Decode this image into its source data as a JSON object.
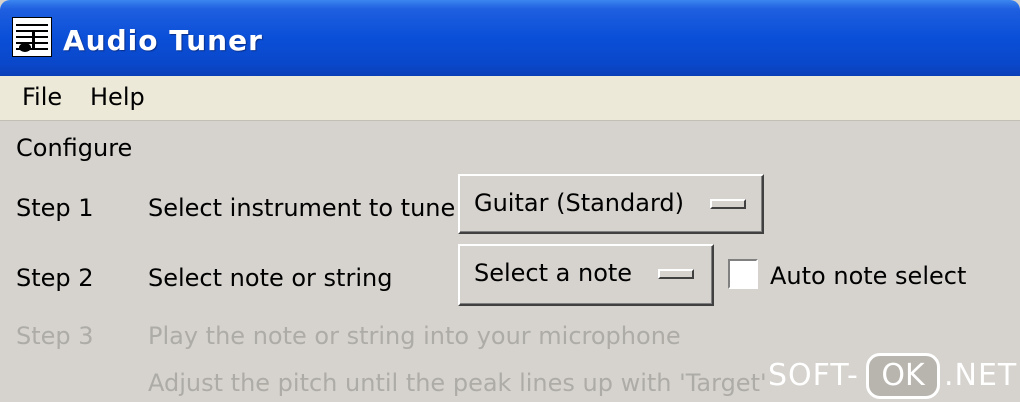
{
  "window": {
    "title": "Audio Tuner"
  },
  "menu": {
    "file": "File",
    "help": "Help"
  },
  "section": {
    "title": "Configure"
  },
  "steps": [
    {
      "label": "Step 1",
      "text": "Select instrument to tune",
      "control": "Guitar (Standard)"
    },
    {
      "label": "Step 2",
      "text": "Select note or string",
      "control": "Select a note"
    },
    {
      "label": "Step 3",
      "text": "Play the note or string into your microphone"
    }
  ],
  "extra_text": "Adjust the pitch until the peak lines up with 'Target'",
  "auto_note": {
    "label": "Auto note select",
    "checked": false
  },
  "watermark": {
    "left": "SOFT-",
    "mid": "OK",
    "right": ".NET"
  }
}
